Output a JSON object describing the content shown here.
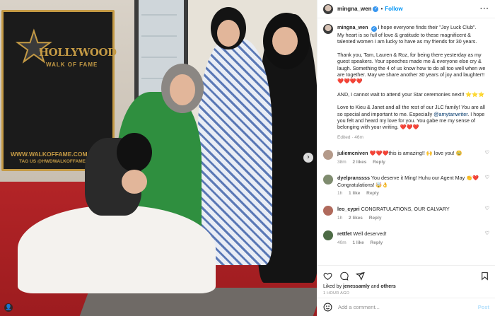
{
  "post": {
    "username": "mingna_wen",
    "follow_label": "Follow",
    "more_label": "···"
  },
  "photo": {
    "sign_line1": "HOLLYWOOD",
    "sign_line2": "WALK OF FAME",
    "sign_url": "WWW.WALKOFFAME.COM",
    "sign_tag": "TAG US @HWDWALKOFFAME",
    "next_arrow": "›"
  },
  "caption": {
    "username": "mingna_wen",
    "first_line": "I hope everyone finds their \"Joy Luck Club\".",
    "paragraphs": [
      "My heart is so full of love & gratitude to these magnificent & talented women I am lucky to have as my friends for 30 years.",
      "Thank you, Tam, Lauren & Roz, for being there yesterday as my guest speakers. Your speeches made me & everyone else cry & laugh. Something the 4 of us know how to do all too well when we are together. May we share another 30 years of joy and laughter!!",
      "AND, I cannot wait to attend your Star ceremonies next!!",
      "Love to Kieu & Janet and all the rest of our JLC family! You are all so special and important to me. Especially",
      "I hope you felt and heard my love for you. You gabe me my sense of belonging with your writing."
    ],
    "hearts_p2": "❤️❤️❤️❤️",
    "stars_p3": "⭐⭐⭐",
    "mention": "@amytanwriter",
    "p4_after": ".",
    "hearts_p5": "❤️❤️❤️",
    "edited": "Edited",
    "edited_time": "46m"
  },
  "comments": [
    {
      "username": "juliemcniven",
      "text": "❤️❤️❤️this is amazing!! 🙌 love you! 🥹",
      "time": "38m",
      "likes": "2 likes",
      "reply": "Reply",
      "avatar_color": "#b49a8a"
    },
    {
      "username": "dyelpranssss",
      "text": "You deserve it Ming! Huhu our Agent May 👏❤️ Congratulations! 🤯👌",
      "time": "1h",
      "likes": "1 like",
      "reply": "Reply",
      "avatar_color": "#7f8c6f"
    },
    {
      "username": "leo_cypri",
      "text": "CONGRATULATIONS, OUR CALVARY",
      "time": "1h",
      "likes": "2 likes",
      "reply": "Reply",
      "avatar_color": "#b06a5c"
    },
    {
      "username": "rettfet",
      "text": "Well deserved!",
      "time": "40m",
      "likes": "1 like",
      "reply": "Reply",
      "avatar_color": "#4d6b45"
    }
  ],
  "actions": {
    "liked_prefix": "Liked by",
    "liked_user": "jenessamly",
    "liked_and": "and",
    "liked_others": "others",
    "time_ago": "1 HOUR AGO"
  },
  "add_comment": {
    "placeholder": "Add a comment...",
    "post_label": "Post"
  },
  "colors": {
    "accent": "#0095f6",
    "verified": "#3897f0",
    "heart": "#ed4956",
    "sign_gold": "#c49a45"
  },
  "icons": [
    "verified-icon",
    "more-icon",
    "heart-icon",
    "comment-icon",
    "share-icon",
    "bookmark-icon",
    "emoji-icon",
    "chevron-right-icon"
  ]
}
